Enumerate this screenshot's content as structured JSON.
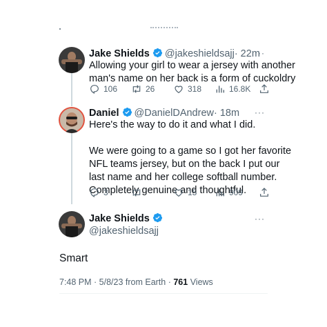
{
  "tweet1": {
    "name": "Jake Shields",
    "handle": "@jakeshieldsajj",
    "time": "· 22m",
    "text_line1": "Allowing your girl to wear a jersey with another",
    "text_line2": "man's name on her back is a form of cuckoldry",
    "replies": "106",
    "retweets": "26",
    "likes": "318",
    "views": "16.8K"
  },
  "tweet2": {
    "name": "Daniel",
    "handle": "@DanielDAndrew",
    "time": "· 18m",
    "text_line1": "Here's the way to do it and what I did.",
    "text_line3": "We were going to a game so I got her favorite",
    "text_line4": "NFL teams jersey, but on the back I put our",
    "text_line5": "last name and her college softball number.",
    "text_line6": "Completely genuine and thoughtful.",
    "replies": "3",
    "retweets": "",
    "likes": "15",
    "views": "909"
  },
  "main": {
    "name": "Jake Shields",
    "handle": "@jakeshieldsajj",
    "text": "Smart",
    "timestamp": "7:48 PM · 5/8/23 from Earth · ",
    "views_count": "761",
    "views_label": " Views"
  },
  "more_label": "···",
  "colors": {
    "verified": "#1d9bf0",
    "muted": "#536471"
  }
}
